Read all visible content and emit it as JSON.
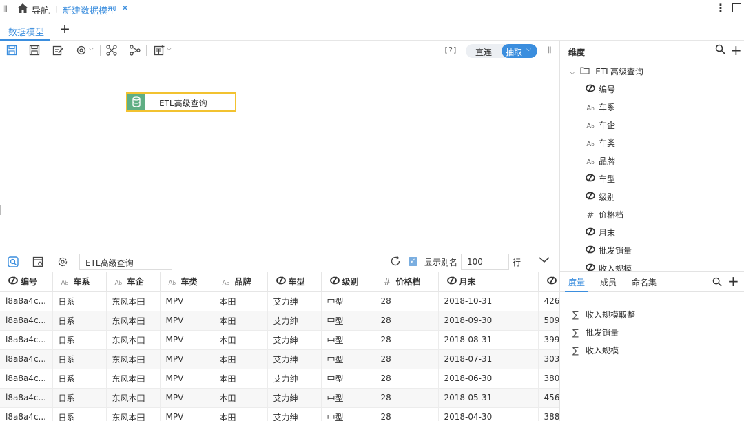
{
  "topbar": {
    "nav_label": "导航",
    "tab_label": "新建数据模型"
  },
  "subtabs": {
    "active_tab": "数据模型"
  },
  "toolbar": {
    "help_label": "[?]",
    "direct_label": "直连",
    "extract_label": "抽取"
  },
  "canvas": {
    "node_label": "ETL高级查询"
  },
  "right_panel": {
    "title": "维度",
    "tree_root": "ETL高级查询",
    "fields": [
      {
        "icon": "dimension-icon",
        "label": "编号"
      },
      {
        "icon": "text-type-icon",
        "label": "车系"
      },
      {
        "icon": "text-type-icon",
        "label": "车企"
      },
      {
        "icon": "text-type-icon",
        "label": "车类"
      },
      {
        "icon": "text-type-icon",
        "label": "品牌"
      },
      {
        "icon": "dimension-icon",
        "label": "车型"
      },
      {
        "icon": "dimension-icon",
        "label": "级别"
      },
      {
        "icon": "number-type-icon",
        "label": "价格档"
      },
      {
        "icon": "dimension-icon",
        "label": "月末"
      },
      {
        "icon": "dimension-icon",
        "label": "批发销量"
      },
      {
        "icon": "dimension-icon",
        "label": "收入规模"
      }
    ],
    "tabs": [
      "度量",
      "成员",
      "命名集"
    ],
    "measures": [
      "收入规模取整",
      "批发销量",
      "收入规模"
    ]
  },
  "bottom_bar": {
    "query_name": "ETL高级查询",
    "alias_label": "显示别名",
    "row_count": "100",
    "row_unit": "行"
  },
  "table": {
    "headers": [
      {
        "icon": "dimension-icon",
        "label": "编号"
      },
      {
        "icon": "text-type-icon",
        "label": "车系"
      },
      {
        "icon": "text-type-icon",
        "label": "车企"
      },
      {
        "icon": "text-type-icon",
        "label": "车类"
      },
      {
        "icon": "text-type-icon",
        "label": "品牌"
      },
      {
        "icon": "dimension-icon",
        "label": "车型"
      },
      {
        "icon": "dimension-icon",
        "label": "级别"
      },
      {
        "icon": "number-type-icon",
        "label": "价格档"
      },
      {
        "icon": "dimension-icon",
        "label": "月末"
      },
      {
        "icon": "dimension-icon",
        "label": ""
      }
    ],
    "rows": [
      [
        "l8a8a4c...",
        "日系",
        "东风本田",
        "MPV",
        "本田",
        "艾力绅",
        "中型",
        "28",
        "2018-10-31",
        "426"
      ],
      [
        "l8a8a4c...",
        "日系",
        "东风本田",
        "MPV",
        "本田",
        "艾力绅",
        "中型",
        "28",
        "2018-09-30",
        "509"
      ],
      [
        "l8a8a4c...",
        "日系",
        "东风本田",
        "MPV",
        "本田",
        "艾力绅",
        "中型",
        "28",
        "2018-08-31",
        "399"
      ],
      [
        "l8a8a4c...",
        "日系",
        "东风本田",
        "MPV",
        "本田",
        "艾力绅",
        "中型",
        "28",
        "2018-07-31",
        "303"
      ],
      [
        "l8a8a4c...",
        "日系",
        "东风本田",
        "MPV",
        "本田",
        "艾力绅",
        "中型",
        "28",
        "2018-06-30",
        "380"
      ],
      [
        "l8a8a4c...",
        "日系",
        "东风本田",
        "MPV",
        "本田",
        "艾力绅",
        "中型",
        "28",
        "2018-05-31",
        "456"
      ],
      [
        "l8a8a4c...",
        "日系",
        "东风本田",
        "MPV",
        "本田",
        "艾力绅",
        "中型",
        "28",
        "2018-04-30",
        "388"
      ]
    ]
  },
  "colors": {
    "accent": "#3b8ede",
    "node_border": "#f2c230",
    "node_icon_bg": "#5fae84"
  }
}
